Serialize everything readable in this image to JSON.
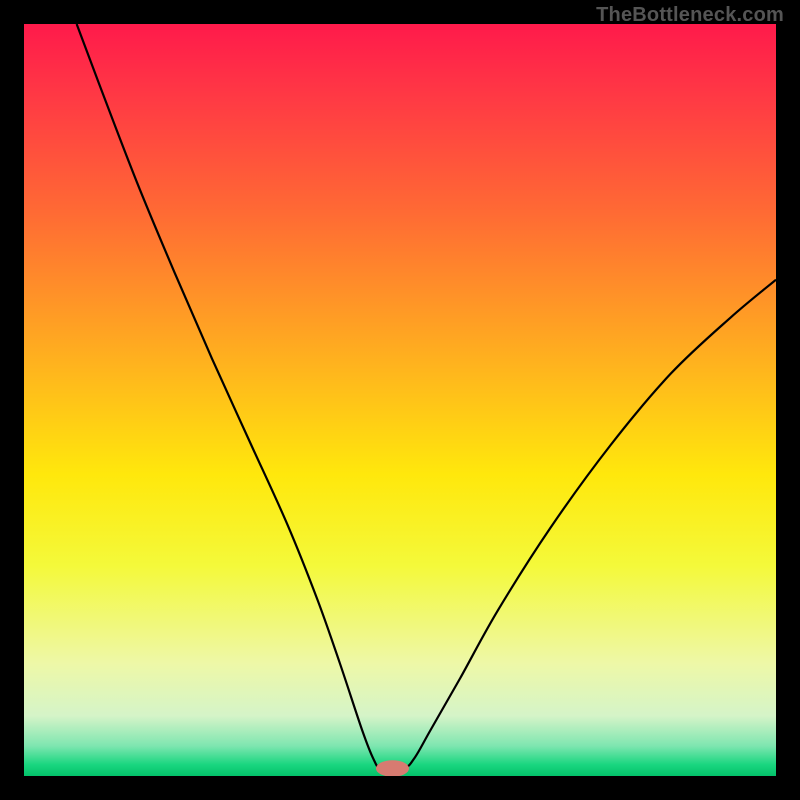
{
  "watermark": "TheBottleneck.com",
  "chart_data": {
    "type": "line",
    "title": "",
    "xlabel": "",
    "ylabel": "",
    "xlim": [
      0,
      100
    ],
    "ylim": [
      0,
      100
    ],
    "background_gradient": {
      "stops": [
        {
          "offset": 0.0,
          "color": "#ff1a4b"
        },
        {
          "offset": 0.1,
          "color": "#ff3a44"
        },
        {
          "offset": 0.25,
          "color": "#ff6a34"
        },
        {
          "offset": 0.45,
          "color": "#ffb21e"
        },
        {
          "offset": 0.6,
          "color": "#ffe80c"
        },
        {
          "offset": 0.72,
          "color": "#f4f93a"
        },
        {
          "offset": 0.85,
          "color": "#eef8a7"
        },
        {
          "offset": 0.92,
          "color": "#d5f4c8"
        },
        {
          "offset": 0.96,
          "color": "#7EE6B0"
        },
        {
          "offset": 0.985,
          "color": "#19d67f"
        },
        {
          "offset": 1.0,
          "color": "#03c16a"
        }
      ]
    },
    "marker": {
      "x": 49,
      "y": 1.0,
      "color": "#d77b71",
      "rx": 2.2,
      "ry": 1.1
    },
    "series": [
      {
        "name": "bottleneck-curve",
        "color": "#000000",
        "width": 2.2,
        "points": [
          {
            "x": 7.0,
            "y": 100.0
          },
          {
            "x": 10.0,
            "y": 92.0
          },
          {
            "x": 15.0,
            "y": 79.0
          },
          {
            "x": 20.0,
            "y": 67.0
          },
          {
            "x": 25.0,
            "y": 55.5
          },
          {
            "x": 30.0,
            "y": 44.5
          },
          {
            "x": 35.0,
            "y": 33.5
          },
          {
            "x": 39.0,
            "y": 23.5
          },
          {
            "x": 42.0,
            "y": 15.0
          },
          {
            "x": 45.0,
            "y": 6.0
          },
          {
            "x": 46.5,
            "y": 2.2
          },
          {
            "x": 47.5,
            "y": 1.0
          },
          {
            "x": 50.5,
            "y": 1.0
          },
          {
            "x": 52.0,
            "y": 2.5
          },
          {
            "x": 54.0,
            "y": 6.0
          },
          {
            "x": 58.0,
            "y": 13.0
          },
          {
            "x": 63.0,
            "y": 22.0
          },
          {
            "x": 70.0,
            "y": 33.0
          },
          {
            "x": 78.0,
            "y": 44.0
          },
          {
            "x": 86.0,
            "y": 53.5
          },
          {
            "x": 94.0,
            "y": 61.0
          },
          {
            "x": 100.0,
            "y": 66.0
          }
        ]
      }
    ]
  }
}
